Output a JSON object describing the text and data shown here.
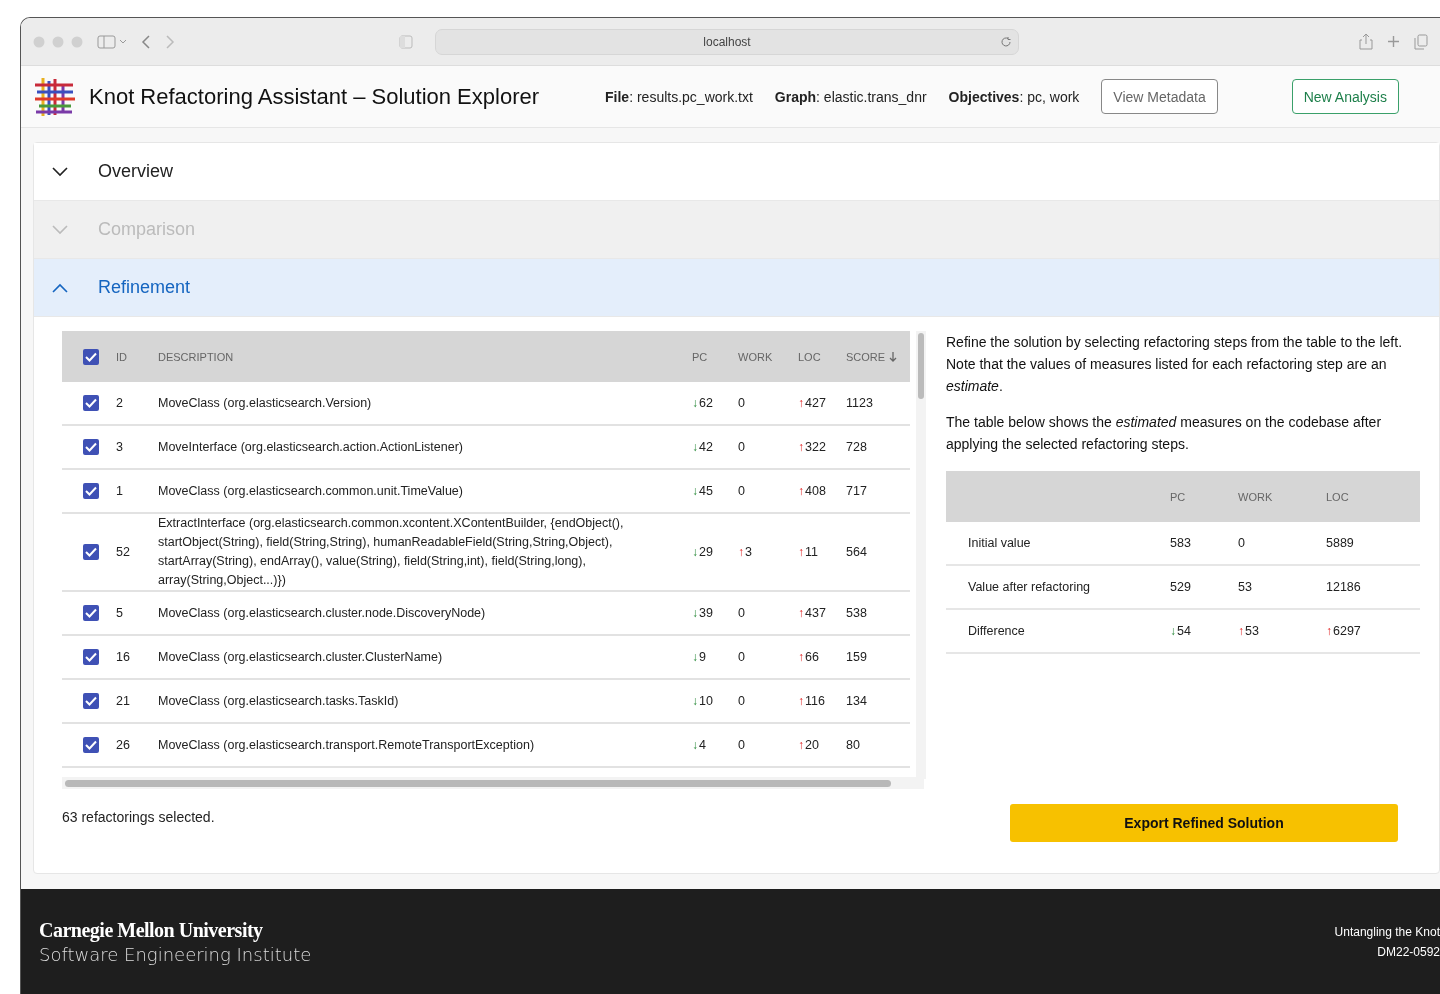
{
  "browser": {
    "url": "localhost"
  },
  "header": {
    "title": "Knot Refactoring Assistant – Solution Explorer",
    "meta": [
      "**File**: results.pc_work.txt",
      "**Graph**: elastic.trans_dnr",
      "**Objectives**: pc, work"
    ],
    "buttons": [
      {
        "label": "View Metadata",
        "kind": "neutral"
      },
      {
        "label": "New Analysis",
        "kind": "primary"
      }
    ]
  },
  "sections": [
    {
      "label": "Overview",
      "expanded": false,
      "disabled": false
    },
    {
      "label": "Comparison",
      "expanded": false,
      "disabled": true
    },
    {
      "label": "Refinement",
      "expanded": true,
      "disabled": false
    }
  ],
  "refactorings": {
    "all_checked": true,
    "columns": [
      {
        "label": "ID",
        "sorted": false
      },
      {
        "label": "DESCRIPTION",
        "sorted": false
      },
      {
        "label": "PC",
        "sorted": false
      },
      {
        "label": "WORK",
        "sorted": false
      },
      {
        "label": "LOC",
        "sorted": false
      },
      {
        "label": "SCORE",
        "sorted": true
      }
    ],
    "rows": [
      {
        "checked": true,
        "id": "2",
        "description": "MoveClass (org.elasticsearch.Version)",
        "pc": {
          "arrow": "↓",
          "increase": false,
          "value": "62"
        },
        "work": {
          "value": "0"
        },
        "loc": {
          "arrow": "↑",
          "increase": true,
          "value": "427"
        },
        "score": "1123"
      },
      {
        "checked": true,
        "id": "3",
        "description": "MoveInterface (org.elasticsearch.action.ActionListener)",
        "pc": {
          "arrow": "↓",
          "increase": false,
          "value": "42"
        },
        "work": {
          "value": "0"
        },
        "loc": {
          "arrow": "↑",
          "increase": true,
          "value": "322"
        },
        "score": "728"
      },
      {
        "checked": true,
        "id": "1",
        "description": "MoveClass (org.elasticsearch.common.unit.TimeValue)",
        "pc": {
          "arrow": "↓",
          "increase": false,
          "value": "45"
        },
        "work": {
          "value": "0"
        },
        "loc": {
          "arrow": "↑",
          "increase": true,
          "value": "408"
        },
        "score": "717"
      },
      {
        "checked": true,
        "id": "52",
        "description": "ExtractInterface (org.elasticsearch.common.xcontent.XContentBuilder, {endObject(), startObject(String), field(String,String), humanReadableField(String,String,Object), startArray(String), endArray(), value(String), field(String,int), field(String,long), array(String,Object...)})",
        "pc": {
          "arrow": "↓",
          "increase": false,
          "value": "29"
        },
        "work": {
          "arrow": "↑",
          "increase": true,
          "value": "3"
        },
        "loc": {
          "arrow": "↑",
          "increase": true,
          "value": "11"
        },
        "score": "564"
      },
      {
        "checked": true,
        "id": "5",
        "description": "MoveClass (org.elasticsearch.cluster.node.DiscoveryNode)",
        "pc": {
          "arrow": "↓",
          "increase": false,
          "value": "39"
        },
        "work": {
          "value": "0"
        },
        "loc": {
          "arrow": "↑",
          "increase": true,
          "value": "437"
        },
        "score": "538"
      },
      {
        "checked": true,
        "id": "16",
        "description": "MoveClass (org.elasticsearch.cluster.ClusterName)",
        "pc": {
          "arrow": "↓",
          "increase": false,
          "value": "9"
        },
        "work": {
          "value": "0"
        },
        "loc": {
          "arrow": "↑",
          "increase": true,
          "value": "66"
        },
        "score": "159"
      },
      {
        "checked": true,
        "id": "21",
        "description": "MoveClass (org.elasticsearch.tasks.TaskId)",
        "pc": {
          "arrow": "↓",
          "increase": false,
          "value": "10"
        },
        "work": {
          "value": "0"
        },
        "loc": {
          "arrow": "↑",
          "increase": true,
          "value": "116"
        },
        "score": "134"
      },
      {
        "checked": true,
        "id": "26",
        "description": "MoveClass (org.elasticsearch.transport.RemoteTransportException)",
        "pc": {
          "arrow": "↓",
          "increase": false,
          "value": "4"
        },
        "work": {
          "value": "0"
        },
        "loc": {
          "arrow": "↑",
          "increase": true,
          "value": "20"
        },
        "score": "80"
      }
    ],
    "selected_count": "63 refactorings selected."
  },
  "summary": {
    "paragraphs": [
      "Refine the solution by selecting refactoring steps from the table to the left. Note that the values of measures listed for each refactoring step are an *estimate*.",
      "The table below shows the *estimated* measures on the codebase after applying the selected refactoring steps."
    ],
    "columns": [
      "PC",
      "WORK",
      "LOC"
    ],
    "rows": [
      {
        "label": "Initial value",
        "cells": [
          {
            "value": "583"
          },
          {
            "value": "0"
          },
          {
            "value": "5889"
          }
        ]
      },
      {
        "label": "Value after refactoring",
        "cells": [
          {
            "value": "529"
          },
          {
            "value": "53"
          },
          {
            "value": "12186"
          }
        ]
      },
      {
        "label": "Difference",
        "cells": [
          {
            "arrow": "↓",
            "increase": false,
            "value": "54"
          },
          {
            "arrow": "↑",
            "increase": true,
            "value": "53"
          },
          {
            "arrow": "↑",
            "increase": true,
            "value": "6297"
          }
        ]
      }
    ],
    "export_button": "Export Refined Solution"
  },
  "footer": {
    "org": "Carnegie Mellon University",
    "unit": "Software Engineering Institute",
    "lines": [
      "Untangling the Knot",
      "DM22-0592"
    ]
  }
}
